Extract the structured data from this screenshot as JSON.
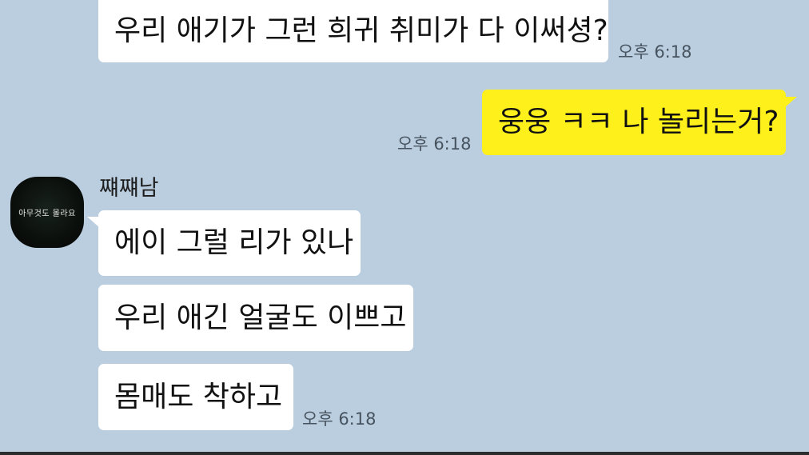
{
  "messages": [
    {
      "side": "in",
      "text": "우리 애기가 그런 희귀 취미가 다 이써셩?",
      "time": "오후 6:18"
    },
    {
      "side": "out",
      "text": "웅웅 ㅋㅋ 나 놀리는거?",
      "time": "오후 6:18"
    },
    {
      "side": "in",
      "sender": "쨰쨰남",
      "avatar_caption": "아무것도 몰라요",
      "text": "에이 그럴 리가 있나"
    },
    {
      "side": "in",
      "text": "우리 애긴 얼굴도 이쁘고"
    },
    {
      "side": "in",
      "text": "몸매도 착하고",
      "time": "오후 6:18"
    }
  ],
  "colors": {
    "background": "#bacee0",
    "incoming_bubble": "#ffffff",
    "outgoing_bubble": "#fef01b",
    "time_text": "#47535f"
  }
}
